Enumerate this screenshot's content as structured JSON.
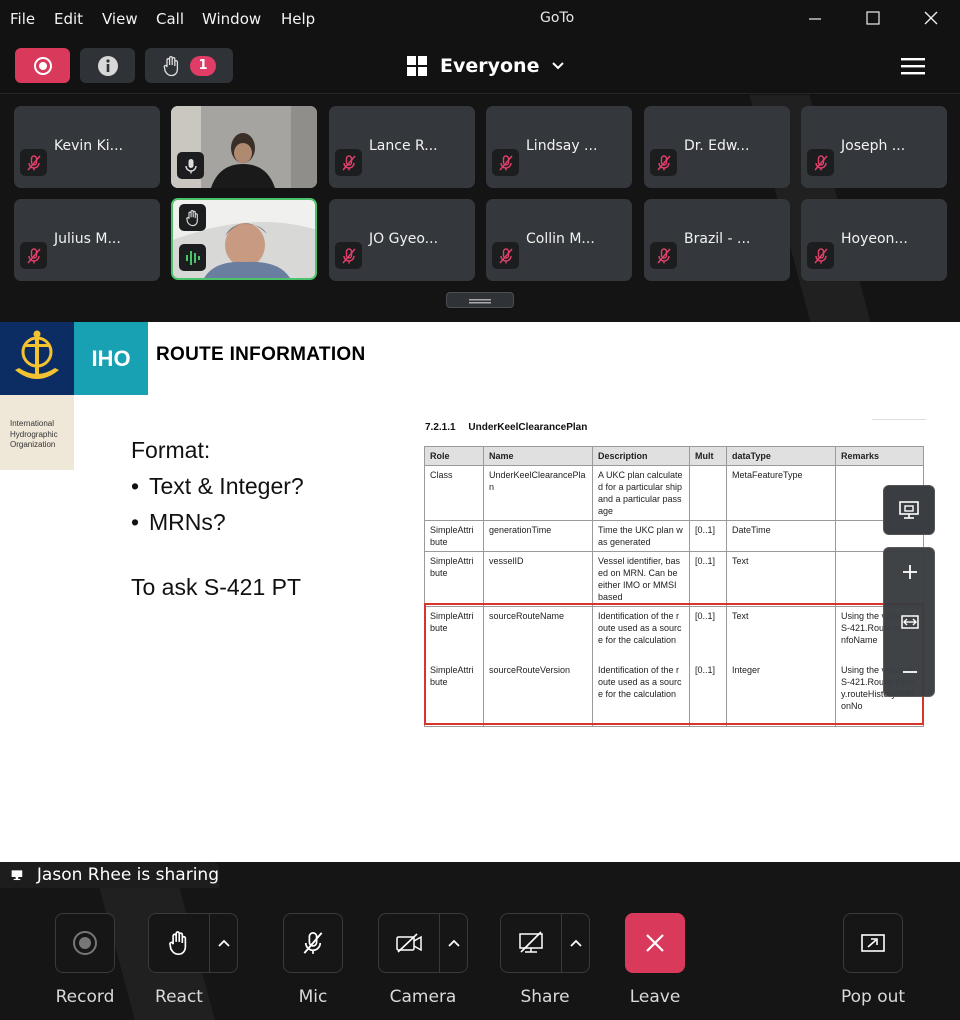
{
  "window": {
    "title": "GoTo",
    "menu": [
      "File",
      "Edit",
      "View",
      "Call",
      "Window",
      "Help"
    ]
  },
  "toolbar": {
    "raised_hands_count": "1",
    "view_label": "Everyone"
  },
  "participants": [
    {
      "name": "Kevin Ki..."
    },
    {
      "name": ""
    },
    {
      "name": "Lance R..."
    },
    {
      "name": "Lindsay ..."
    },
    {
      "name": "Dr. Edw..."
    },
    {
      "name": "Joseph ..."
    },
    {
      "name": "Julius M..."
    },
    {
      "name": ""
    },
    {
      "name": "JO Gyeo..."
    },
    {
      "name": "Collin M..."
    },
    {
      "name": "Brazil - ..."
    },
    {
      "name": "Hoyeon..."
    }
  ],
  "slide": {
    "logo_text": "IHO",
    "org_lines": [
      "International",
      "Hydrographic",
      "Organization"
    ],
    "title": "ROUTE INFORMATION",
    "format_label": "Format:",
    "bullets": [
      "Text & Integer?",
      "MRNs?"
    ],
    "ask": "To ask S-421 PT",
    "spec_number": "7.2.1.1",
    "spec_title": "UnderKeelClearancePlan",
    "table": {
      "headers": [
        "Role",
        "Name",
        "Description",
        "Mult",
        "dataType",
        "Remarks"
      ],
      "rows": [
        [
          "Class",
          "UnderKeelClearancePlan",
          "A UKC plan calculated for a particular ship and a particular passage",
          "",
          "MetaFeatureType",
          ""
        ],
        [
          "SimpleAttribute",
          "generationTime",
          "Time the UKC plan was generated",
          "[0..1]",
          "DateTime",
          ""
        ],
        [
          "SimpleAttribute",
          "vesselID",
          "Vessel identifier, based on MRN. Can be either IMO or MMSI based",
          "[0..1]",
          "Text",
          ""
        ],
        [
          "SimpleAttribute",
          "sourceRouteName",
          "Identification of the route used as a source for the calculation",
          "[0..1]",
          "Text",
          "Using the value of S-421.Route.routeInfoName"
        ],
        [
          "SimpleAttribute",
          "sourceRouteVersion",
          "Identification of the route used as a source for the calculation",
          "[0..1]",
          "Integer",
          "Using the value of S-421.RouteHistory.routeHistoryEditionNo"
        ]
      ]
    }
  },
  "sharing": {
    "banner": "Jason Rhee is sharing"
  },
  "controls": {
    "record": "Record",
    "react": "React",
    "mic": "Mic",
    "camera": "Camera",
    "share": "Share",
    "leave": "Leave",
    "popout": "Pop out"
  },
  "colors": {
    "accent": "#d93a5b",
    "tile": "#34383c",
    "speaking": "#4cc26b",
    "muted_icon": "#e0406a",
    "highlight": "#d9342b"
  }
}
